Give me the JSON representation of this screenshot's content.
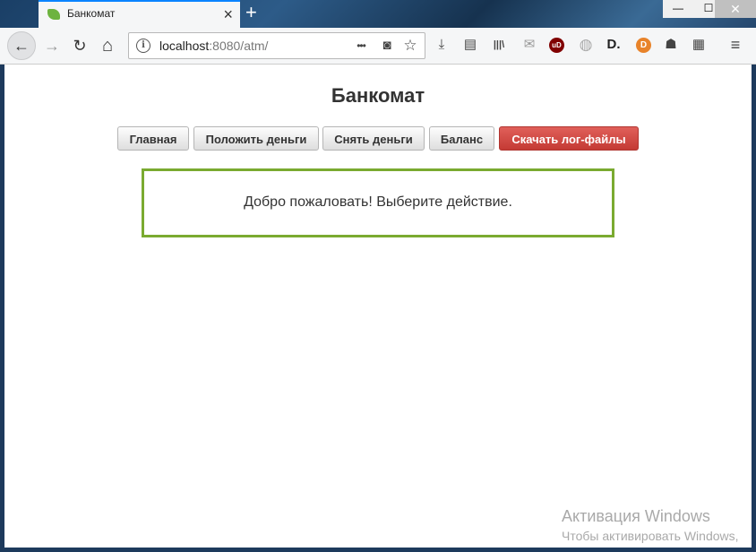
{
  "browser": {
    "tab": {
      "title": "Банкомат",
      "close_icon": "×",
      "new_tab_icon": "+"
    },
    "window": {
      "minimize": "—",
      "maximize": "☐",
      "close": "✕"
    },
    "url": {
      "host": "localhost",
      "rest": ":8080/atm/"
    },
    "icons": {
      "back": "←",
      "forward": "→",
      "reload": "↻",
      "home": "⌂",
      "more": "•••",
      "pocket": "◙",
      "bookmark": "☆",
      "download": "⤓",
      "reader": "▤",
      "library": "|||\\",
      "mail": "✉",
      "ublock": "uD",
      "globe": "◍",
      "d_ext": "D.",
      "d_round": "D",
      "user_ext": "☗",
      "notes": "▦",
      "menu": "≡"
    },
    "colors": {
      "accent": "#0a84ff",
      "danger": "#c9413b",
      "box_border": "#7aaa30"
    }
  },
  "page": {
    "title": "Банкомат",
    "buttons": {
      "home": "Главная",
      "deposit": "Положить деньги",
      "withdraw": "Снять деньги",
      "balance": "Баланс",
      "download_logs": "Скачать лог-файлы"
    },
    "message": "Добро пожаловать! Выберите действие."
  },
  "watermark": {
    "title": "Активация Windows",
    "subtitle": "Чтобы активировать Windows,"
  }
}
